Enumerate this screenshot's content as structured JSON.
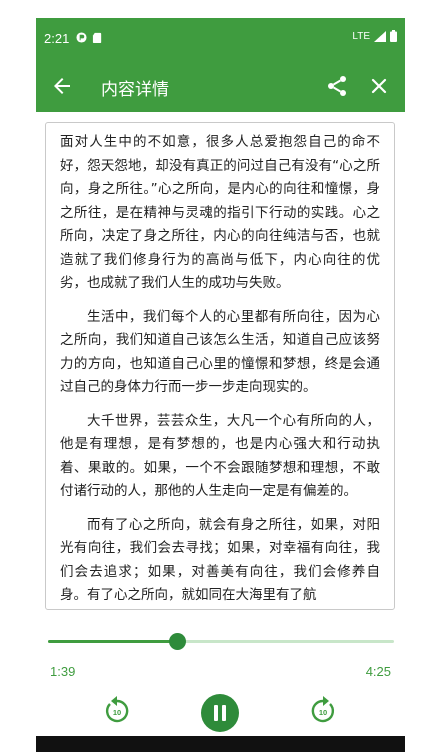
{
  "status_bar": {
    "time": "2:21",
    "network": "LTE"
  },
  "app_bar": {
    "title": "内容详情"
  },
  "article": {
    "paragraphs": [
      "面对人生中的不如意，很多人总爱抱怨自己的命不好，怨天怨地，却没有真正的问过自己有没有“心之所向，身之所往。”心之所向，是内心的向往和憧憬，身之所往，是在精神与灵魂的指引下行动的实践。心之所向，决定了身之所往，内心的向往纯洁与否，也就造就了我们修身行为的高尚与低下，内心向往的优劣，也成就了我们人生的成功与失败。",
      "生活中，我们每个人的心里都有所向往，因为心之所向，我们知道自己该怎么生活，知道自己应该努力的方向，也知道自己心里的憧憬和梦想，终是会通过自己的身体力行而一步一步走向现实的。",
      "大千世界，芸芸众生，大凡一个心有所向的人，他是有理想，是有梦想的，也是内心强大和行动执着、果敢的。如果，一个不会跟随梦想和理想，不敢付诸行动的人，那他的人生走向一定是有偏差的。",
      "而有了心之所向，就会有身之所往，如果，对阳光有向往，我们会去寻找；如果，对幸福有向往，我们会去追求；如果，对善美有向往，我们会修养自身。有了心之所向，就如同在大海里有了航"
    ]
  },
  "player": {
    "elapsed": "1:39",
    "duration": "4:25",
    "progress": 0.373,
    "rewind_seconds": "10",
    "forward_seconds": "10"
  },
  "colors": {
    "primary": "#3f9c3f",
    "dark": "#2e8b3a",
    "track": "#c8e6c9"
  }
}
